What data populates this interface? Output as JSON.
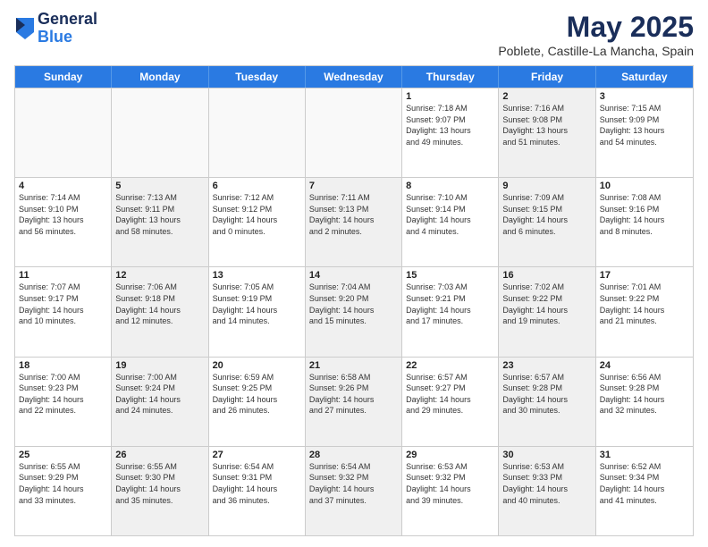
{
  "header": {
    "logo_general": "General",
    "logo_blue": "Blue",
    "month_title": "May 2025",
    "location": "Poblete, Castille-La Mancha, Spain"
  },
  "days_of_week": [
    "Sunday",
    "Monday",
    "Tuesday",
    "Wednesday",
    "Thursday",
    "Friday",
    "Saturday"
  ],
  "weeks": [
    [
      {
        "day": "",
        "info": "",
        "shaded": false,
        "empty": true
      },
      {
        "day": "",
        "info": "",
        "shaded": false,
        "empty": true
      },
      {
        "day": "",
        "info": "",
        "shaded": false,
        "empty": true
      },
      {
        "day": "",
        "info": "",
        "shaded": false,
        "empty": true
      },
      {
        "day": "1",
        "info": "Sunrise: 7:18 AM\nSunset: 9:07 PM\nDaylight: 13 hours\nand 49 minutes.",
        "shaded": false,
        "empty": false
      },
      {
        "day": "2",
        "info": "Sunrise: 7:16 AM\nSunset: 9:08 PM\nDaylight: 13 hours\nand 51 minutes.",
        "shaded": true,
        "empty": false
      },
      {
        "day": "3",
        "info": "Sunrise: 7:15 AM\nSunset: 9:09 PM\nDaylight: 13 hours\nand 54 minutes.",
        "shaded": false,
        "empty": false
      }
    ],
    [
      {
        "day": "4",
        "info": "Sunrise: 7:14 AM\nSunset: 9:10 PM\nDaylight: 13 hours\nand 56 minutes.",
        "shaded": false,
        "empty": false
      },
      {
        "day": "5",
        "info": "Sunrise: 7:13 AM\nSunset: 9:11 PM\nDaylight: 13 hours\nand 58 minutes.",
        "shaded": true,
        "empty": false
      },
      {
        "day": "6",
        "info": "Sunrise: 7:12 AM\nSunset: 9:12 PM\nDaylight: 14 hours\nand 0 minutes.",
        "shaded": false,
        "empty": false
      },
      {
        "day": "7",
        "info": "Sunrise: 7:11 AM\nSunset: 9:13 PM\nDaylight: 14 hours\nand 2 minutes.",
        "shaded": true,
        "empty": false
      },
      {
        "day": "8",
        "info": "Sunrise: 7:10 AM\nSunset: 9:14 PM\nDaylight: 14 hours\nand 4 minutes.",
        "shaded": false,
        "empty": false
      },
      {
        "day": "9",
        "info": "Sunrise: 7:09 AM\nSunset: 9:15 PM\nDaylight: 14 hours\nand 6 minutes.",
        "shaded": true,
        "empty": false
      },
      {
        "day": "10",
        "info": "Sunrise: 7:08 AM\nSunset: 9:16 PM\nDaylight: 14 hours\nand 8 minutes.",
        "shaded": false,
        "empty": false
      }
    ],
    [
      {
        "day": "11",
        "info": "Sunrise: 7:07 AM\nSunset: 9:17 PM\nDaylight: 14 hours\nand 10 minutes.",
        "shaded": false,
        "empty": false
      },
      {
        "day": "12",
        "info": "Sunrise: 7:06 AM\nSunset: 9:18 PM\nDaylight: 14 hours\nand 12 minutes.",
        "shaded": true,
        "empty": false
      },
      {
        "day": "13",
        "info": "Sunrise: 7:05 AM\nSunset: 9:19 PM\nDaylight: 14 hours\nand 14 minutes.",
        "shaded": false,
        "empty": false
      },
      {
        "day": "14",
        "info": "Sunrise: 7:04 AM\nSunset: 9:20 PM\nDaylight: 14 hours\nand 15 minutes.",
        "shaded": true,
        "empty": false
      },
      {
        "day": "15",
        "info": "Sunrise: 7:03 AM\nSunset: 9:21 PM\nDaylight: 14 hours\nand 17 minutes.",
        "shaded": false,
        "empty": false
      },
      {
        "day": "16",
        "info": "Sunrise: 7:02 AM\nSunset: 9:22 PM\nDaylight: 14 hours\nand 19 minutes.",
        "shaded": true,
        "empty": false
      },
      {
        "day": "17",
        "info": "Sunrise: 7:01 AM\nSunset: 9:22 PM\nDaylight: 14 hours\nand 21 minutes.",
        "shaded": false,
        "empty": false
      }
    ],
    [
      {
        "day": "18",
        "info": "Sunrise: 7:00 AM\nSunset: 9:23 PM\nDaylight: 14 hours\nand 22 minutes.",
        "shaded": false,
        "empty": false
      },
      {
        "day": "19",
        "info": "Sunrise: 7:00 AM\nSunset: 9:24 PM\nDaylight: 14 hours\nand 24 minutes.",
        "shaded": true,
        "empty": false
      },
      {
        "day": "20",
        "info": "Sunrise: 6:59 AM\nSunset: 9:25 PM\nDaylight: 14 hours\nand 26 minutes.",
        "shaded": false,
        "empty": false
      },
      {
        "day": "21",
        "info": "Sunrise: 6:58 AM\nSunset: 9:26 PM\nDaylight: 14 hours\nand 27 minutes.",
        "shaded": true,
        "empty": false
      },
      {
        "day": "22",
        "info": "Sunrise: 6:57 AM\nSunset: 9:27 PM\nDaylight: 14 hours\nand 29 minutes.",
        "shaded": false,
        "empty": false
      },
      {
        "day": "23",
        "info": "Sunrise: 6:57 AM\nSunset: 9:28 PM\nDaylight: 14 hours\nand 30 minutes.",
        "shaded": true,
        "empty": false
      },
      {
        "day": "24",
        "info": "Sunrise: 6:56 AM\nSunset: 9:28 PM\nDaylight: 14 hours\nand 32 minutes.",
        "shaded": false,
        "empty": false
      }
    ],
    [
      {
        "day": "25",
        "info": "Sunrise: 6:55 AM\nSunset: 9:29 PM\nDaylight: 14 hours\nand 33 minutes.",
        "shaded": false,
        "empty": false
      },
      {
        "day": "26",
        "info": "Sunrise: 6:55 AM\nSunset: 9:30 PM\nDaylight: 14 hours\nand 35 minutes.",
        "shaded": true,
        "empty": false
      },
      {
        "day": "27",
        "info": "Sunrise: 6:54 AM\nSunset: 9:31 PM\nDaylight: 14 hours\nand 36 minutes.",
        "shaded": false,
        "empty": false
      },
      {
        "day": "28",
        "info": "Sunrise: 6:54 AM\nSunset: 9:32 PM\nDaylight: 14 hours\nand 37 minutes.",
        "shaded": true,
        "empty": false
      },
      {
        "day": "29",
        "info": "Sunrise: 6:53 AM\nSunset: 9:32 PM\nDaylight: 14 hours\nand 39 minutes.",
        "shaded": false,
        "empty": false
      },
      {
        "day": "30",
        "info": "Sunrise: 6:53 AM\nSunset: 9:33 PM\nDaylight: 14 hours\nand 40 minutes.",
        "shaded": true,
        "empty": false
      },
      {
        "day": "31",
        "info": "Sunrise: 6:52 AM\nSunset: 9:34 PM\nDaylight: 14 hours\nand 41 minutes.",
        "shaded": false,
        "empty": false
      }
    ]
  ]
}
